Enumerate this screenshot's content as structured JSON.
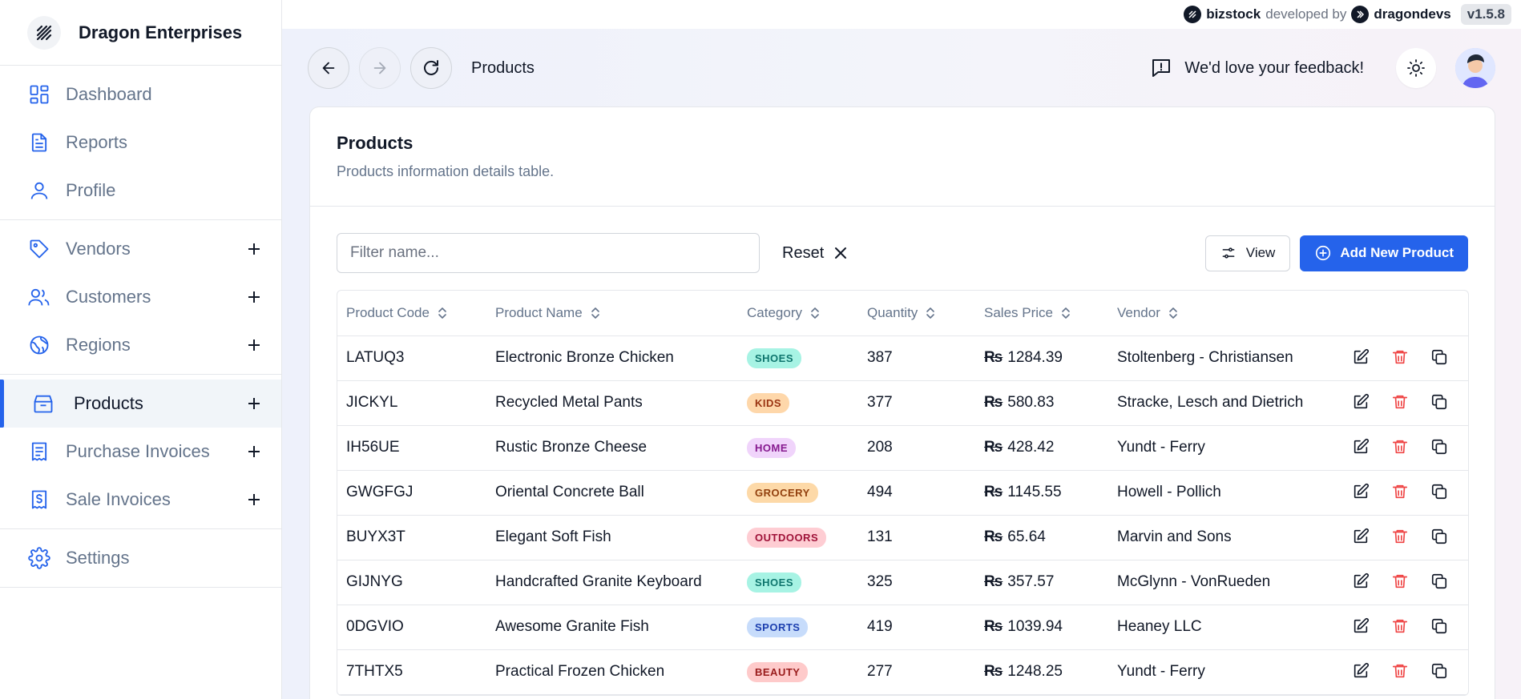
{
  "brand": {
    "name": "Dragon Enterprises"
  },
  "topstrip": {
    "product": "bizstock",
    "developed_by": "developed by",
    "company": "dragondevs",
    "version": "v1.5.8"
  },
  "sidebar": {
    "items": [
      {
        "label": "Dashboard",
        "icon": "dashboard-icon"
      },
      {
        "label": "Reports",
        "icon": "document-icon"
      },
      {
        "label": "Profile",
        "icon": "user-icon"
      },
      {
        "label": "Vendors",
        "icon": "tag-icon"
      },
      {
        "label": "Customers",
        "icon": "users-icon"
      },
      {
        "label": "Regions",
        "icon": "globe-icon"
      },
      {
        "label": "Products",
        "icon": "box-icon"
      },
      {
        "label": "Purchase Invoices",
        "icon": "receipt-icon"
      },
      {
        "label": "Sale Invoices",
        "icon": "dollar-receipt-icon"
      },
      {
        "label": "Settings",
        "icon": "gear-icon"
      }
    ]
  },
  "header": {
    "breadcrumb": "Products",
    "feedback": "We'd love your feedback!"
  },
  "card": {
    "title": "Products",
    "subtitle": "Products information details table."
  },
  "toolbar": {
    "filter_placeholder": "Filter name...",
    "reset_label": "Reset",
    "view_label": "View",
    "add_label": "Add New Product"
  },
  "table": {
    "columns": [
      "Product Code",
      "Product Name",
      "Category",
      "Quantity",
      "Sales Price",
      "Vendor"
    ],
    "currency": "₨",
    "rows": [
      {
        "code": "LATUQ3",
        "name": "Electronic Bronze Chicken",
        "category": "SHOES",
        "quantity": "387",
        "price": "1284.39",
        "vendor": "Stoltenberg - Christiansen"
      },
      {
        "code": "JICKYL",
        "name": "Recycled Metal Pants",
        "category": "KIDS",
        "quantity": "377",
        "price": "580.83",
        "vendor": "Stracke, Lesch and Dietrich"
      },
      {
        "code": "IH56UE",
        "name": "Rustic Bronze Cheese",
        "category": "HOME",
        "quantity": "208",
        "price": "428.42",
        "vendor": "Yundt - Ferry"
      },
      {
        "code": "GWGFGJ",
        "name": "Oriental Concrete Ball",
        "category": "GROCERY",
        "quantity": "494",
        "price": "1145.55",
        "vendor": "Howell - Pollich"
      },
      {
        "code": "BUYX3T",
        "name": "Elegant Soft Fish",
        "category": "OUTDOORS",
        "quantity": "131",
        "price": "65.64",
        "vendor": "Marvin and Sons"
      },
      {
        "code": "GIJNYG",
        "name": "Handcrafted Granite Keyboard",
        "category": "SHOES",
        "quantity": "325",
        "price": "357.57",
        "vendor": "McGlynn - VonRueden"
      },
      {
        "code": "0DGVIO",
        "name": "Awesome Granite Fish",
        "category": "SPORTS",
        "quantity": "419",
        "price": "1039.94",
        "vendor": "Heaney LLC"
      },
      {
        "code": "7THTX5",
        "name": "Practical Frozen Chicken",
        "category": "BEAUTY",
        "quantity": "277",
        "price": "1248.25",
        "vendor": "Yundt - Ferry"
      }
    ]
  },
  "colors": {
    "accent": "#2563eb",
    "badges": {
      "SHOES": {
        "bg": "#a7f3e4",
        "fg": "#0f766e"
      },
      "KIDS": {
        "bg": "#fed7aa",
        "fg": "#9a3412"
      },
      "HOME": {
        "bg": "#f0d4fb",
        "fg": "#86198f"
      },
      "GROCERY": {
        "bg": "#fdd9a8",
        "fg": "#92400e"
      },
      "OUTDOORS": {
        "bg": "#fecdd3",
        "fg": "#9f1239"
      },
      "SPORTS": {
        "bg": "#c7dcfb",
        "fg": "#1e40af"
      },
      "BEAUTY": {
        "bg": "#fecaca",
        "fg": "#991b1b"
      }
    }
  }
}
